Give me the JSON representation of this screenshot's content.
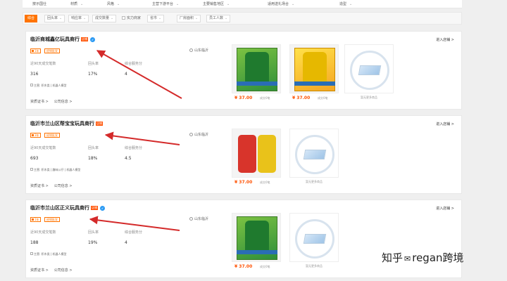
{
  "attr_bar": {
    "items": [
      {
        "label": "按示国仕",
        "arrow": ""
      },
      {
        "label": "材质",
        "arrow": "⌄"
      },
      {
        "label": "风格",
        "arrow": "⌄"
      },
      {
        "label": "主营下游平台",
        "arrow": "⌄"
      },
      {
        "label": "主要销售地区",
        "arrow": "⌄"
      },
      {
        "label": "适用送礼场合",
        "arrow": "⌄"
      },
      {
        "label": "造型",
        "arrow": "⌄"
      }
    ]
  },
  "filter_bar": {
    "buttons": [
      {
        "label": "综合",
        "active": true
      },
      {
        "label": "回头率",
        "arrow": "⌄"
      },
      {
        "label": "响应率",
        "arrow": "⌄"
      },
      {
        "label": "成交数量",
        "arrow": "⌄"
      }
    ],
    "check": "实力商家",
    "selects": [
      {
        "label": "省市",
        "arrow": "⌄"
      },
      {
        "label": "厂房面积",
        "arrow": "⌄"
      },
      {
        "label": "员工人数",
        "arrow": "⌄"
      }
    ]
  },
  "stats_labels": {
    "transactions": "近90天成交笔数",
    "repeat_rate": "回头率",
    "rating": "综合服务分"
  },
  "links": {
    "certificate": "资质证书 >",
    "credit": "公司信息 >"
  },
  "enter_shop": "进入店铺 >",
  "companies": [
    {
      "name": "临沂商城鑫亿玩具商行",
      "tag": "店铺",
      "verified": "✓",
      "years": "1年",
      "merchant_type": "经销批发",
      "location": "山东临沂",
      "transactions": "316",
      "repeat_rate": "17%",
      "rating": "4",
      "categories": "主营: 积木类 | 机器人模型",
      "products": [
        {
          "kind": "green",
          "price": "¥ 37.00",
          "sold": "成交0笔"
        },
        {
          "kind": "yellow",
          "price": "¥ 37.00",
          "sold": "成交0笔"
        },
        {
          "kind": "none",
          "caption": "暂无更多商品"
        }
      ]
    },
    {
      "name": "临沂市兰山区帮宝宝玩具商行",
      "tag": "店铺",
      "verified": "",
      "years": "3年",
      "merchant_type": "经销批发",
      "location": "山东临沂",
      "transactions": "693",
      "repeat_rate": "18%",
      "rating": "4.5",
      "categories": "主营: 积木类 | 趣味公仔 | 机器人模型",
      "products": [
        {
          "kind": "redyellow",
          "price": "¥ 37.00",
          "sold": "成交0笔"
        },
        {
          "kind": "none",
          "caption": "暂无更多商品"
        }
      ]
    },
    {
      "name": "临沂市兰山区正义玩具商行",
      "tag": "店铺",
      "verified": "✓",
      "years": "1年",
      "merchant_type": "经销批发",
      "location": "山东临沂",
      "transactions": "188",
      "repeat_rate": "19%",
      "rating": "4",
      "categories": "主营: 积木类 | 机器人模型",
      "products": [
        {
          "kind": "green",
          "price": "¥ 37.00",
          "sold": "成交0笔"
        },
        {
          "kind": "none",
          "caption": "暂无更多商品"
        }
      ]
    }
  ],
  "watermark": {
    "brand": "知乎",
    "handle": "regan跨境"
  }
}
